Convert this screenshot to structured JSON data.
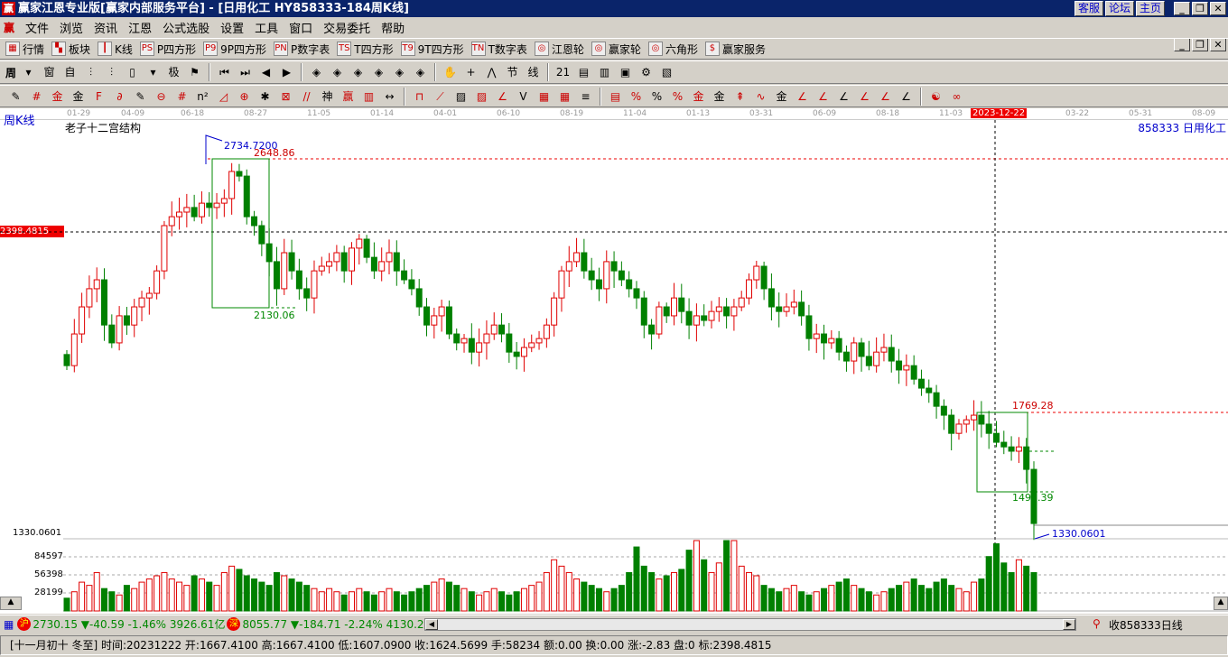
{
  "window": {
    "title": "赢家江恩专业版[赢家内部服务平台] - [日用化工   HY858333-184周K线]",
    "logo": "赢",
    "links": [
      "客服",
      "论坛",
      "主页"
    ],
    "controls": [
      "_",
      "❐",
      "✕"
    ]
  },
  "menu": {
    "logo": "赢",
    "items": [
      "文件",
      "浏览",
      "资讯",
      "江恩",
      "公式选股",
      "设置",
      "工具",
      "窗口",
      "交易委托",
      "帮助"
    ]
  },
  "toolbar1": [
    {
      "icon": "quote-table-icon",
      "glyph": "▦",
      "label": "行情"
    },
    {
      "icon": "sector-icon",
      "glyph": "▚",
      "label": "板块"
    },
    {
      "icon": "kline-icon",
      "glyph": "┃",
      "label": "K线"
    },
    {
      "icon": "ps-icon",
      "glyph": "PS",
      "label": "P四方形"
    },
    {
      "icon": "p9-icon",
      "glyph": "P9",
      "label": "9P四方形"
    },
    {
      "icon": "pn-icon",
      "glyph": "PN",
      "label": "P数字表"
    },
    {
      "icon": "ts-icon",
      "glyph": "TS",
      "label": "T四方形"
    },
    {
      "icon": "t9-icon",
      "glyph": "T9",
      "label": "9T四方形"
    },
    {
      "icon": "tn-icon",
      "glyph": "TN",
      "label": "T数字表"
    },
    {
      "icon": "gann-wheel-icon",
      "glyph": "◎",
      "label": "江恩轮"
    },
    {
      "icon": "winner-wheel-icon",
      "glyph": "◎",
      "label": "赢家轮"
    },
    {
      "icon": "hexagon-icon",
      "glyph": "◎",
      "label": "六角形"
    },
    {
      "icon": "dollar-icon",
      "glyph": "$",
      "label": "赢家服务"
    }
  ],
  "toolbar2": {
    "period": "周",
    "icons": [
      {
        "n": "chart-type-icon",
        "g": "▾"
      },
      {
        "n": "weight-icon",
        "g": "窗"
      },
      {
        "n": "self-icon",
        "g": "自"
      },
      {
        "n": "bars3-icon",
        "g": "⫶"
      },
      {
        "n": "bars9-icon",
        "g": "⫶"
      },
      {
        "n": "candle-type-icon",
        "g": "▯"
      },
      {
        "n": "drop-icon",
        "g": "▾"
      },
      {
        "n": "stop-icon",
        "g": "极"
      },
      {
        "n": "flag-icon",
        "g": "⚑"
      },
      {
        "n": "first-icon",
        "g": "⏮"
      },
      {
        "n": "last-icon",
        "g": "⏭"
      },
      {
        "n": "left-icon",
        "g": "◀"
      },
      {
        "n": "right-icon",
        "g": "▶"
      },
      {
        "n": "diamond-left-icon",
        "g": "◈"
      },
      {
        "n": "diamond-right-icon",
        "g": "◈"
      },
      {
        "n": "diamond-expand-icon",
        "g": "◈"
      },
      {
        "n": "diamond-shrink-icon",
        "g": "◈"
      },
      {
        "n": "diamond-star-icon",
        "g": "◈"
      },
      {
        "n": "diamond-vert-icon",
        "g": "◈"
      },
      {
        "n": "hand-icon",
        "g": "✋"
      },
      {
        "n": "crosshair-icon",
        "g": "+"
      },
      {
        "n": "zigzag-icon",
        "g": "⋀"
      },
      {
        "n": "section-icon",
        "g": "节"
      },
      {
        "n": "wave-icon",
        "g": "线"
      },
      {
        "n": "calendar-icon",
        "g": "21"
      },
      {
        "n": "calculator-icon",
        "g": "▤"
      },
      {
        "n": "notes-icon",
        "g": "▥"
      },
      {
        "n": "save-icon",
        "g": "▣"
      },
      {
        "n": "find-icon",
        "g": "⚙"
      },
      {
        "n": "print-icon",
        "g": "▧"
      }
    ]
  },
  "toolbar3": {
    "icons": [
      {
        "n": "pen-icon",
        "g": "✎"
      },
      {
        "n": "hash-icon",
        "g": "#"
      },
      {
        "n": "gold1-icon",
        "g": "金"
      },
      {
        "n": "gold2-icon",
        "g": "金"
      },
      {
        "n": "fib-icon",
        "g": "F"
      },
      {
        "n": "spiral-icon",
        "g": "∂"
      },
      {
        "n": "fan-icon",
        "g": "✎"
      },
      {
        "n": "circle-icon",
        "g": "⊖"
      },
      {
        "n": "parallel-icon",
        "g": "#"
      },
      {
        "n": "n2-icon",
        "g": "n²"
      },
      {
        "n": "triangle-icon",
        "g": "◿"
      },
      {
        "n": "target-icon",
        "g": "⊕"
      },
      {
        "n": "star-icon",
        "g": "✱"
      },
      {
        "n": "square-icon",
        "g": "⊠"
      },
      {
        "n": "lines-icon",
        "g": "//"
      },
      {
        "n": "shen-icon",
        "g": "神"
      },
      {
        "n": "ying-icon",
        "g": "赢"
      },
      {
        "n": "grid-icon",
        "g": "▥"
      },
      {
        "n": "measure-icon",
        "g": "↔"
      },
      {
        "n": "box-icon",
        "g": "⊓"
      },
      {
        "n": "ray-fan-icon",
        "g": "⟋"
      },
      {
        "n": "gann-box-icon",
        "g": "▨"
      },
      {
        "n": "gann-fan-icon",
        "g": "▨"
      },
      {
        "n": "angle-icon",
        "g": "∠"
      },
      {
        "n": "v-icon",
        "g": "V"
      },
      {
        "n": "grid2-icon",
        "g": "▦"
      },
      {
        "n": "grid3-icon",
        "g": "▦"
      },
      {
        "n": "slash-icon",
        "g": "≡"
      },
      {
        "n": "table-icon",
        "g": "▤"
      },
      {
        "n": "percent-line-icon",
        "g": "%"
      },
      {
        "n": "percent-icon",
        "g": "%"
      },
      {
        "n": "percent-lines-icon",
        "g": "%"
      },
      {
        "n": "gold-circle-icon",
        "g": "金"
      },
      {
        "n": "gold-lines-icon",
        "g": "金"
      },
      {
        "n": "arrow-fan-icon",
        "g": "⇞"
      },
      {
        "n": "wave2-icon",
        "g": "∿"
      },
      {
        "n": "gold-bar-icon",
        "g": "金"
      },
      {
        "n": "j-angle-icon",
        "g": "∠"
      },
      {
        "n": "f-angle-icon",
        "g": "∠"
      },
      {
        "n": "gold-angle-icon",
        "g": "∠"
      },
      {
        "n": "shen-angle-icon",
        "g": "∠"
      },
      {
        "n": "ying-angle-icon",
        "g": "∠"
      },
      {
        "n": "four-angle-icon",
        "g": "∠"
      },
      {
        "n": "yinyang-icon",
        "g": "☯"
      },
      {
        "n": "infinity-icon",
        "g": "∞"
      }
    ]
  },
  "chart": {
    "period_label": "周K线",
    "indicator_name": "老子十二宫结构",
    "symbol": "858333 日用化工",
    "dates": [
      "01-29",
      "04-09",
      "06-18",
      "08-27",
      "11-05",
      "01-14",
      "04-01",
      "06-10",
      "08-19",
      "11-04",
      "01-13",
      "03-31",
      "06-09",
      "08-18",
      "11-03",
      "2023-12-22",
      "03-22",
      "05-31",
      "08-09"
    ],
    "cursor_price": "2398.4815",
    "low_label": "1330.0601",
    "high_point": "2734.7200",
    "levels": {
      "box1_top": "2648.86",
      "box1_bottom": "2130.06",
      "box2_top": "1769.28",
      "box2_bottom": "1491.39",
      "low": "1330.0601"
    },
    "volume_ticks": [
      "84597",
      "56398",
      "28199"
    ]
  },
  "chart_data": {
    "type": "candlestick",
    "period": "weekly",
    "ylim": [
      1330.06,
      2734.72
    ],
    "closes": [
      1931,
      2041,
      2135,
      2198,
      2229,
      2072,
      2010,
      2104,
      2072,
      2135,
      2166,
      2182,
      2260,
      2417,
      2448,
      2464,
      2480,
      2448,
      2495,
      2480,
      2495,
      2511,
      2605,
      2589,
      2448,
      2417,
      2354,
      2292,
      2198,
      2323,
      2260,
      2198,
      2166,
      2260,
      2276,
      2292,
      2323,
      2260,
      2339,
      2370,
      2307,
      2260,
      2292,
      2323,
      2260,
      2229,
      2198,
      2135,
      2072,
      2104,
      2135,
      2041,
      2010,
      2025,
      1978,
      2010,
      2041,
      2072,
      2041,
      1978,
      1963,
      1994,
      2010,
      2025,
      2072,
      2166,
      2260,
      2292,
      2323,
      2260,
      2229,
      2198,
      2292,
      2260,
      2229,
      2198,
      2166,
      2072,
      2041,
      2135,
      2104,
      2166,
      2119,
      2072,
      2104,
      2088,
      2119,
      2135,
      2104,
      2135,
      2166,
      2229,
      2276,
      2198,
      2135,
      2119,
      2135,
      2151,
      2104,
      2025,
      2041,
      2010,
      2025,
      1978,
      1947,
      2010,
      1963,
      1931,
      1978,
      1994,
      1947,
      1916,
      1931,
      1884,
      1853,
      1837,
      1790,
      1759,
      1696,
      1728,
      1743,
      1759,
      1728,
      1696,
      1665,
      1649,
      1634,
      1649,
      1571,
      1383
    ],
    "volumes": [
      20,
      30,
      45,
      40,
      60,
      35,
      30,
      25,
      40,
      35,
      45,
      50,
      55,
      60,
      50,
      45,
      40,
      55,
      50,
      45,
      40,
      60,
      70,
      65,
      55,
      50,
      45,
      40,
      60,
      55,
      50,
      45,
      40,
      35,
      30,
      35,
      30,
      25,
      30,
      35,
      30,
      25,
      30,
      35,
      30,
      25,
      30,
      35,
      40,
      45,
      50,
      45,
      40,
      35,
      30,
      25,
      30,
      35,
      30,
      25,
      30,
      35,
      40,
      45,
      60,
      80,
      70,
      60,
      50,
      45,
      40,
      35,
      30,
      35,
      40,
      60,
      100,
      70,
      60,
      50,
      55,
      60,
      65,
      95,
      110,
      80,
      60,
      75,
      110,
      110,
      70,
      60,
      55,
      40,
      35,
      30,
      35,
      40,
      30,
      25,
      30,
      35,
      40,
      45,
      50,
      40,
      35,
      30,
      25,
      30,
      35,
      40,
      45,
      50,
      40,
      35,
      45,
      50,
      40,
      35,
      30,
      45,
      50,
      85,
      105,
      75,
      60,
      80,
      70,
      60
    ],
    "vol_unit": "thousand"
  },
  "status": {
    "sh": {
      "badge": "沪",
      "value": "2730.15",
      "change": "▼-40.59",
      "pct": "-1.46%",
      "amount": "3926.61亿"
    },
    "sz": {
      "badge": "深",
      "value": "8055.77",
      "change": "▼-184.71",
      "pct": "-2.24%",
      "amount": "4130.2"
    },
    "right": "收858333日线"
  },
  "info": "[十一月初十 冬至] 时间:20231222 开:1667.4100 高:1667.4100 低:1607.0900 收:1624.5699 手:58234 额:0.00 换:0.00 涨:-2.83 盘:0 标:2398.4815",
  "colors": {
    "up": "#e00000",
    "down": "#008000",
    "title": "#0a246a"
  }
}
